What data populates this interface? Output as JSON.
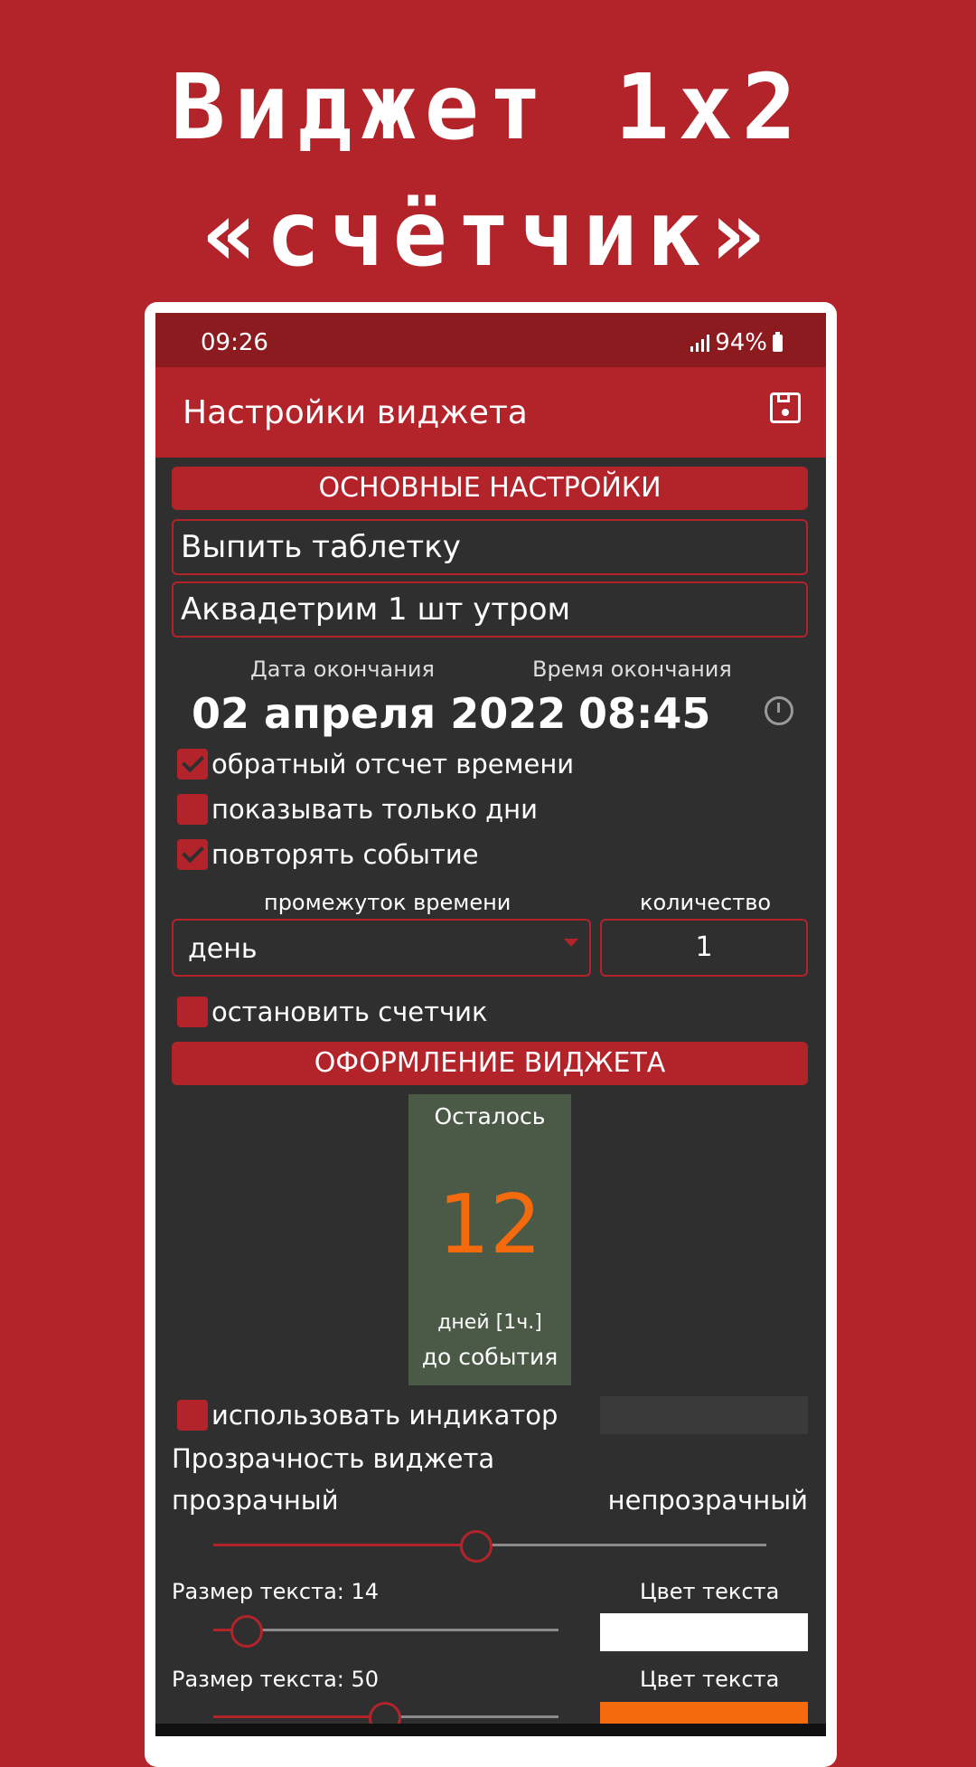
{
  "promo": {
    "line1": "Виджет 1x2",
    "line2": "«счётчик»"
  },
  "statusbar": {
    "time": "09:26",
    "battery": "94%"
  },
  "appbar": {
    "title": "Настройки виджета",
    "save_icon": "save-icon"
  },
  "main_settings": {
    "header": "ОСНОВНЫЕ НАСТРОЙКИ",
    "event_title": "Выпить таблетку",
    "event_note": "Аквадетрим 1 шт утром",
    "end_date_label": "Дата окончания",
    "end_date_value": "02 апреля 2022",
    "end_time_label": "Время окончания",
    "end_time_value": "08:45",
    "checkboxes": [
      {
        "label": "обратный отсчет времени",
        "checked": true
      },
      {
        "label": "показывать только дни",
        "checked": false
      },
      {
        "label": "повторять событие",
        "checked": true
      }
    ],
    "interval_label": "промежуток времени",
    "interval_value": "день",
    "count_label": "количество",
    "count_value": "1",
    "stop_counter": {
      "label": "остановить счетчик",
      "checked": false
    }
  },
  "widget_design": {
    "header": "ОФОРМЛЕНИЕ ВИДЖЕТА",
    "preview": {
      "top_text": "Осталось",
      "number": "12",
      "unit_text": "дней [1ч.]",
      "bottom_text": "до события",
      "background_color": "#4b5a47",
      "number_color": "#f46a0d"
    },
    "use_indicator": {
      "label": "использовать индикатор",
      "checked": false
    },
    "transparency_label": "Прозрачность виджета",
    "transparent_label": "прозрачный",
    "opaque_label": "непрозрачный",
    "transparency_value": 0.47,
    "text_size_1_label": "Размер текста: 14",
    "text_size_1_value": 14,
    "text_color_1_label": "Цвет текста",
    "text_color_1": "#ffffff",
    "text_size_2_label": "Размер текста: 50",
    "text_size_2_value": 50,
    "text_color_2_label": "Цвет текста",
    "text_color_2": "#f46a0d"
  },
  "colors": {
    "accent": "#b3232a",
    "background": "#2f2f30"
  }
}
